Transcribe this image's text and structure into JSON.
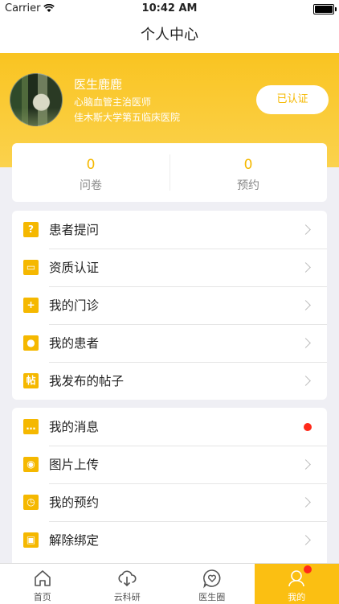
{
  "status_bar": {
    "carrier": "Carrier",
    "time": "10:42 AM"
  },
  "nav": {
    "title": "个人中心"
  },
  "profile": {
    "name": "医生鹿鹿",
    "title": "心脑血管主治医师",
    "hospital": "佳木斯大学第五临床医院",
    "verified_label": "已认证"
  },
  "stats": [
    {
      "value": "0",
      "label": "问卷"
    },
    {
      "value": "0",
      "label": "预约"
    }
  ],
  "menu_group_1": [
    {
      "label": "患者提问",
      "icon": "question-icon",
      "glyph": "?"
    },
    {
      "label": "资质认证",
      "icon": "id-card-icon",
      "glyph": "▭"
    },
    {
      "label": "我的门诊",
      "icon": "clinic-icon",
      "glyph": "+"
    },
    {
      "label": "我的患者",
      "icon": "patients-icon",
      "glyph": "●"
    },
    {
      "label": "我发布的帖子",
      "icon": "post-icon",
      "glyph": "帖"
    }
  ],
  "menu_group_2": [
    {
      "label": "我的消息",
      "icon": "message-icon",
      "glyph": "…",
      "unread": true
    },
    {
      "label": "图片上传",
      "icon": "camera-icon",
      "glyph": "◉"
    },
    {
      "label": "我的预约",
      "icon": "clock-icon",
      "glyph": "◷"
    },
    {
      "label": "解除绑定",
      "icon": "lock-icon",
      "glyph": "▣"
    }
  ],
  "tabs": [
    {
      "label": "首页",
      "icon": "home-icon"
    },
    {
      "label": "云科研",
      "icon": "cloud-download-icon"
    },
    {
      "label": "医生圈",
      "icon": "heart-chat-icon"
    },
    {
      "label": "我的",
      "icon": "profile-icon",
      "active": true,
      "badge": true
    }
  ],
  "colors": {
    "accent": "#f5b800",
    "header": "#fbc72a",
    "badge": "#ff2a1a"
  }
}
